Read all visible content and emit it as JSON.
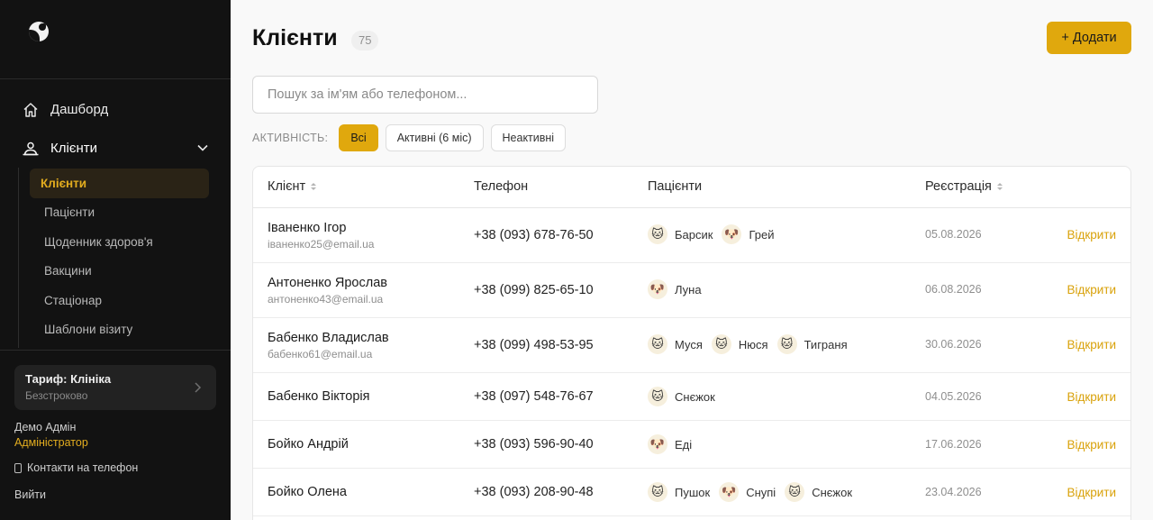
{
  "sidebar": {
    "nav": {
      "dashboard": "Дашборд",
      "clients": "Клієнти"
    },
    "sub_items": [
      "Клієнти",
      "Пацієнти",
      "Щоденник здоров'я",
      "Вакцини",
      "Стаціонар",
      "Шаблони візиту"
    ],
    "plan": {
      "title": "Тариф: Клініка",
      "subtitle": "Безстроково"
    },
    "user": {
      "name": "Демо Адмін",
      "role": "Адміністратор"
    },
    "contacts": "Контакти на телефон",
    "logout": "Вийти"
  },
  "header": {
    "title": "Клієнти",
    "count": "75",
    "add_button": "+ Додати"
  },
  "search": {
    "placeholder": "Пошук за ім'ям або телефоном..."
  },
  "filters": {
    "label": "АКТИВНІСТЬ:",
    "options": [
      "Всі",
      "Активні (6 міс)",
      "Неактивні"
    ],
    "selected": "Всі"
  },
  "table": {
    "headers": {
      "client": "Клієнт",
      "phone": "Телефон",
      "patients": "Пацієнти",
      "registration": "Реєстрація"
    },
    "open_label": "Відкрити",
    "rows": [
      {
        "name": "Іваненко Ігор",
        "email": "іваненко25@email.ua",
        "phone": "+38 (093) 678-76-50",
        "pets": [
          {
            "icon": "cat",
            "name": "Барсик"
          },
          {
            "icon": "dog",
            "name": "Грей"
          }
        ],
        "date": "05.08.2026"
      },
      {
        "name": "Антоненко Ярослав",
        "email": "антоненко43@email.ua",
        "phone": "+38 (099) 825-65-10",
        "pets": [
          {
            "icon": "dog",
            "name": "Луна"
          }
        ],
        "date": "06.08.2026"
      },
      {
        "name": "Бабенко Владислав",
        "email": "бабенко61@email.ua",
        "phone": "+38 (099) 498-53-95",
        "pets": [
          {
            "icon": "cat",
            "name": "Муся"
          },
          {
            "icon": "cat",
            "name": "Нюся"
          },
          {
            "icon": "cat",
            "name": "Тиграня"
          }
        ],
        "date": "30.06.2026"
      },
      {
        "name": "Бабенко Вікторія",
        "email": "",
        "phone": "+38 (097) 548-76-67",
        "pets": [
          {
            "icon": "cat",
            "name": "Снєжок"
          }
        ],
        "date": "04.05.2026"
      },
      {
        "name": "Бойко Андрій",
        "email": "",
        "phone": "+38 (093) 596-90-40",
        "pets": [
          {
            "icon": "dog",
            "name": "Еді"
          }
        ],
        "date": "17.06.2026"
      },
      {
        "name": "Бойко Олена",
        "email": "",
        "phone": "+38 (093) 208-90-48",
        "pets": [
          {
            "icon": "cat",
            "name": "Пушок"
          },
          {
            "icon": "dog",
            "name": "Снупі"
          },
          {
            "icon": "cat",
            "name": "Снєжок"
          }
        ],
        "date": "23.04.2026"
      }
    ]
  },
  "colors": {
    "accent": "#e0a80d",
    "sidebar_bg": "#121212",
    "link": "#d9a20b"
  }
}
